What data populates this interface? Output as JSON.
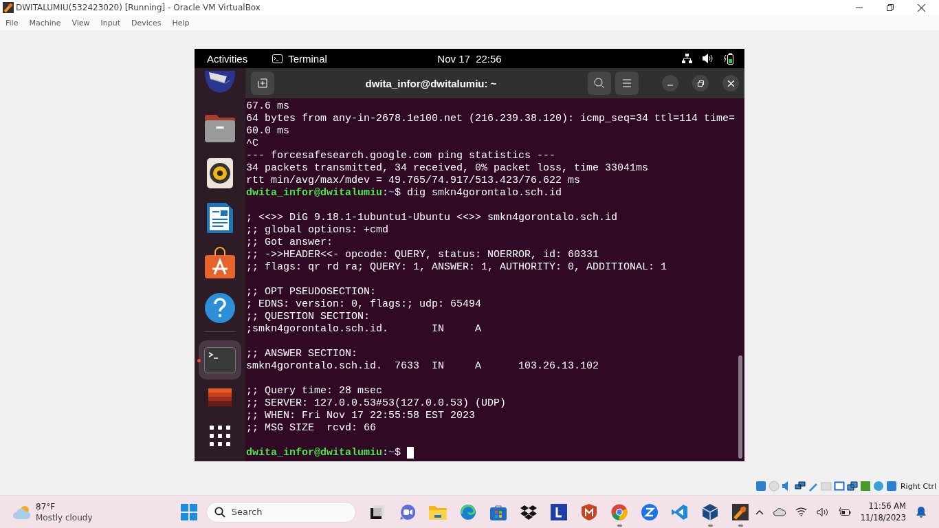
{
  "window": {
    "title": "DWITALUMIU(532423020) [Running] - Oracle VM VirtualBox"
  },
  "menu": [
    "File",
    "Machine",
    "View",
    "Input",
    "Devices",
    "Help"
  ],
  "guest": {
    "top_bar": {
      "activities": "Activities",
      "app": "Terminal",
      "clock": "Nov 17  22:56"
    },
    "dock": [
      {
        "kind": "mail",
        "active": false
      },
      {
        "kind": "files",
        "active": false
      },
      {
        "kind": "music",
        "active": false
      },
      {
        "kind": "writer",
        "active": false
      },
      {
        "kind": "store",
        "active": false
      },
      {
        "kind": "help",
        "active": false
      },
      {
        "kind": "terminal",
        "active": true
      },
      {
        "kind": "stack",
        "active": false
      },
      {
        "kind": "apps",
        "active": false
      }
    ],
    "terminal": {
      "title": "dwita_infor@dwitalumiu: ~",
      "lines": [
        {
          "kind": "output",
          "text": "67.6 ms"
        },
        {
          "kind": "output",
          "text": "64 bytes from any-in-2678.1e100.net (216.239.38.120): icmp_seq=34 ttl=114 time="
        },
        {
          "kind": "output",
          "text": "60.0 ms"
        },
        {
          "kind": "output",
          "text": "^C"
        },
        {
          "kind": "output",
          "text": "--- forcesafesearch.google.com ping statistics ---"
        },
        {
          "kind": "output",
          "text": "34 packets transmitted, 34 received, 0% packet loss, time 33041ms"
        },
        {
          "kind": "output",
          "text": "rtt min/avg/max/mdev = 49.765/74.917/513.423/76.622 ms"
        },
        {
          "kind": "prompt",
          "user": "dwita_infor@dwitalumiu",
          "colon": ":",
          "path": "~",
          "rest": "$ dig smkn4gorontalo.sch.id",
          "cursor": false
        },
        {
          "kind": "blank"
        },
        {
          "kind": "output",
          "text": "; <<>> DiG 9.18.1-1ubuntu1-Ubuntu <<>> smkn4gorontalo.sch.id"
        },
        {
          "kind": "output",
          "text": ";; global options: +cmd"
        },
        {
          "kind": "output",
          "text": ";; Got answer:"
        },
        {
          "kind": "output",
          "text": ";; ->>HEADER<<- opcode: QUERY, status: NOERROR, id: 60331"
        },
        {
          "kind": "output",
          "text": ";; flags: qr rd ra; QUERY: 1, ANSWER: 1, AUTHORITY: 0, ADDITIONAL: 1"
        },
        {
          "kind": "blank"
        },
        {
          "kind": "output",
          "text": ";; OPT PSEUDOSECTION:"
        },
        {
          "kind": "output",
          "text": "; EDNS: version: 0, flags:; udp: 65494"
        },
        {
          "kind": "output",
          "text": ";; QUESTION SECTION:"
        },
        {
          "kind": "output",
          "text": ";smkn4gorontalo.sch.id.       IN     A"
        },
        {
          "kind": "blank"
        },
        {
          "kind": "output",
          "text": ";; ANSWER SECTION:"
        },
        {
          "kind": "output",
          "text": "smkn4gorontalo.sch.id.  7633  IN     A      103.26.13.102"
        },
        {
          "kind": "blank"
        },
        {
          "kind": "output",
          "text": ";; Query time: 28 msec"
        },
        {
          "kind": "output",
          "text": ";; SERVER: 127.0.0.53#53(127.0.0.53) (UDP)"
        },
        {
          "kind": "output",
          "text": ";; WHEN: Fri Nov 17 22:55:58 EST 2023"
        },
        {
          "kind": "output",
          "text": ";; MSG SIZE  rcvd: 66"
        },
        {
          "kind": "blank"
        },
        {
          "kind": "prompt",
          "user": "dwita_infor@dwitalumiu",
          "colon": ":",
          "path": "~",
          "rest": "$ ",
          "cursor": true
        }
      ]
    }
  },
  "status_bar": {
    "host_key": "Right Ctrl"
  },
  "taskbar": {
    "weather": {
      "temp": "87°F",
      "condition": "Mostly cloudy"
    },
    "search": {
      "placeholder": "Search"
    },
    "apps": [
      {
        "kind": "task-view",
        "running": false
      },
      {
        "kind": "meet",
        "running": false
      },
      {
        "kind": "folder",
        "running": false
      },
      {
        "kind": "edge",
        "running": false
      },
      {
        "kind": "store",
        "running": false
      },
      {
        "kind": "dropbox",
        "running": false
      },
      {
        "kind": "letter",
        "running": false
      },
      {
        "kind": "shield",
        "running": false
      },
      {
        "kind": "chrome",
        "running": true
      },
      {
        "kind": "zoom",
        "running": false
      },
      {
        "kind": "code",
        "running": false
      },
      {
        "kind": "cube",
        "running": true
      },
      {
        "kind": "vm",
        "running": true
      }
    ],
    "time": "11:56 AM",
    "date": "11/18/2023"
  }
}
